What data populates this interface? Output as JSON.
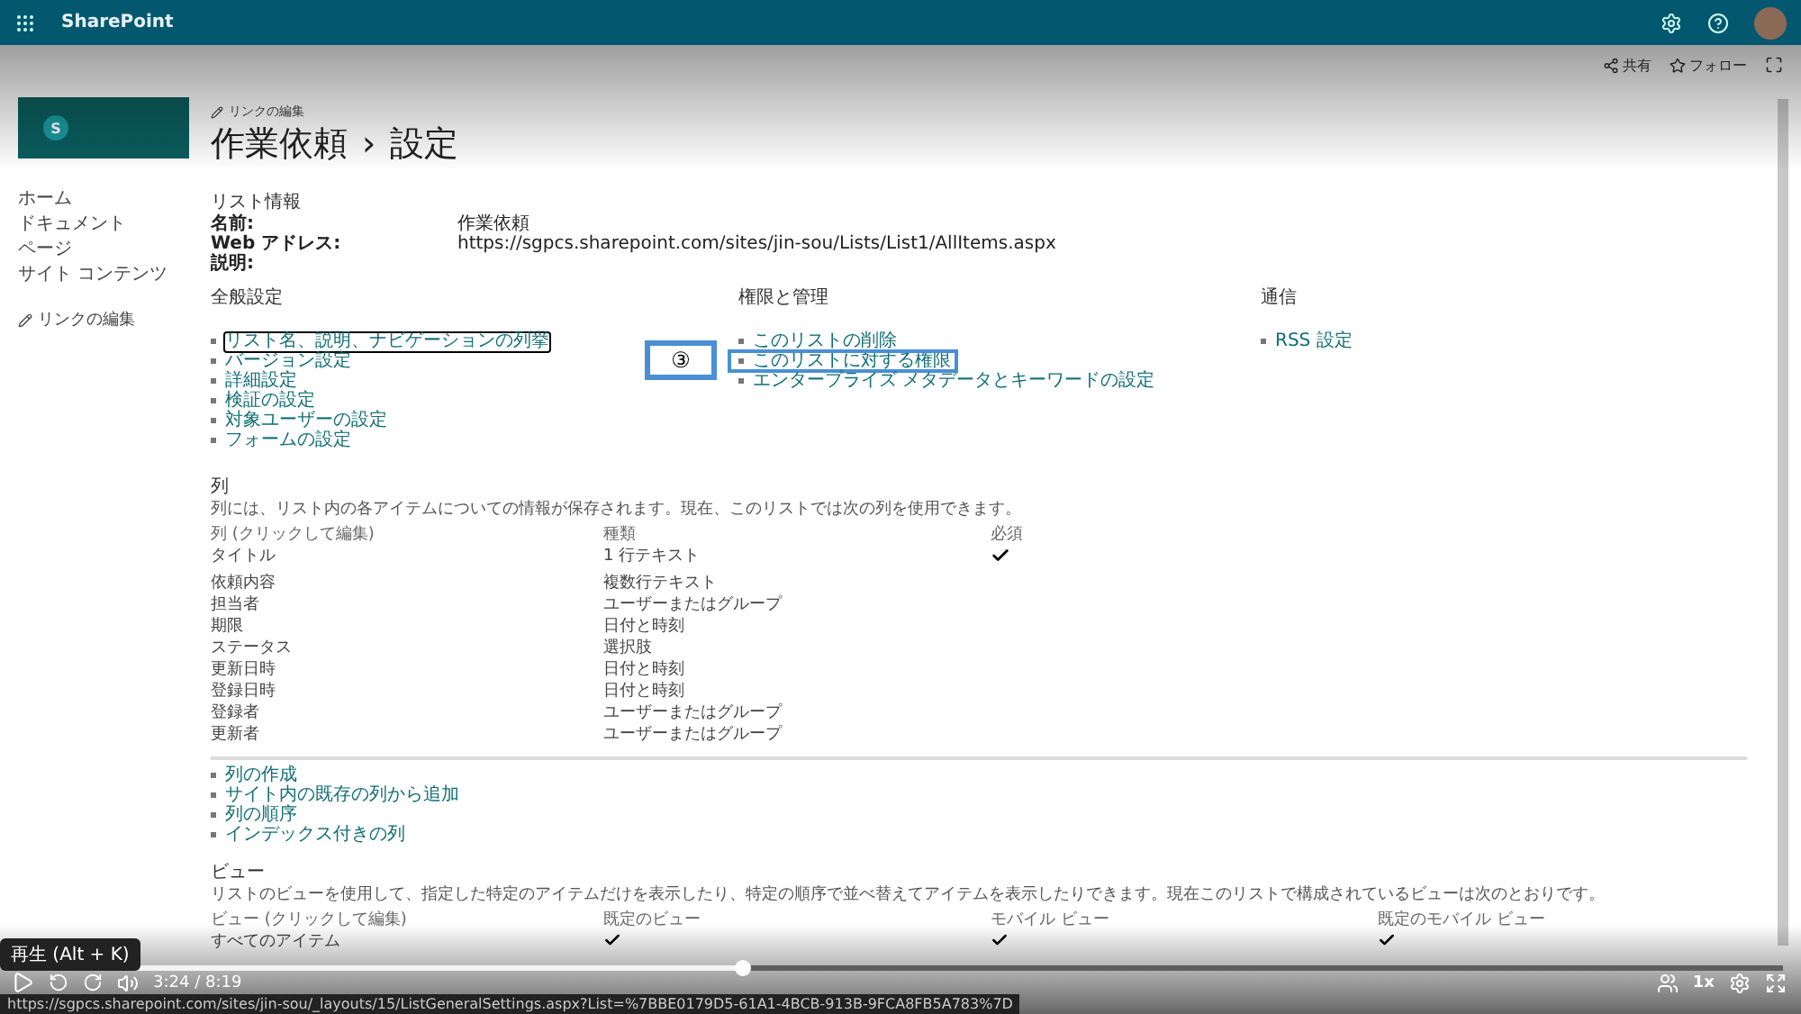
{
  "suite_bar": {
    "app_name": "SharePoint"
  },
  "command_bar": [
    {
      "label": "共有"
    },
    {
      "label": "フォロー"
    }
  ],
  "header": {
    "logo_letter": "S",
    "edit_link": "リンクの編集",
    "title": "作業依頼",
    "separator": "›",
    "subtitle": "設定"
  },
  "left_nav": {
    "items": [
      {
        "label": "ホーム"
      },
      {
        "label": "ドキュメント"
      },
      {
        "label": "ページ"
      },
      {
        "label": "サイト コンテンツ"
      }
    ],
    "edit_link": "リンクの編集"
  },
  "list_info": {
    "heading": "リスト情報",
    "fields": [
      {
        "label": "名前:",
        "value": "作業依頼"
      },
      {
        "label": "Web アドレス:",
        "value": "https://sgpcs.sharepoint.com/sites/jin-sou/Lists/List1/AllItems.aspx"
      },
      {
        "label": "説明:"
      }
    ]
  },
  "settings_sections": [
    {
      "heading": "全般設定",
      "links": [
        {
          "label": "リスト名、説明、ナビゲーションの列挙",
          "focused": true
        },
        {
          "label": "バージョン設定",
          "focused": false
        },
        {
          "label": "詳細設定",
          "focused": false
        },
        {
          "label": "検証の設定",
          "focused": false
        },
        {
          "label": "対象ユーザーの設定",
          "focused": false
        },
        {
          "label": "フォームの設定",
          "focused": false
        }
      ]
    },
    {
      "heading": "権限と管理",
      "links": [
        {
          "label": "このリストの削除",
          "focused": false
        },
        {
          "label": "このリストに対する権限",
          "focused": false,
          "callout": "③"
        },
        {
          "label": "エンタープライズ メタデータとキーワードの設定",
          "focused": false
        }
      ]
    },
    {
      "heading": "通信",
      "links": [
        {
          "label": "RSS 設定",
          "focused": false
        }
      ]
    }
  ],
  "columns": {
    "heading": "列",
    "description": "列には、リスト内の各アイテムについての情報が保存されます。現在、このリストでは次の列を使用できます。",
    "headers": [
      "列 (クリックして編集)",
      "種類",
      "必須"
    ],
    "rows": [
      {
        "name": "タイトル",
        "type": "1 行テキスト",
        "required": true
      },
      {
        "name": "依頼内容",
        "type": "複数行テキスト",
        "required": false
      },
      {
        "name": "担当者",
        "type": "ユーザーまたはグループ",
        "required": false
      },
      {
        "name": "期限",
        "type": "日付と時刻",
        "required": false
      },
      {
        "name": "ステータス",
        "type": "選択肢",
        "required": false
      },
      {
        "name": "更新日時",
        "type": "日付と時刻",
        "required": false
      },
      {
        "name": "登録日時",
        "type": "日付と時刻",
        "required": false
      },
      {
        "name": "登録者",
        "type": "ユーザーまたはグループ",
        "required": false
      },
      {
        "name": "更新者",
        "type": "ユーザーまたはグループ",
        "required": false
      }
    ],
    "links": [
      "列の作成",
      "サイト内の既存の列から追加",
      "列の順序",
      "インデックス付きの列"
    ]
  },
  "views": {
    "heading": "ビュー",
    "description": "リストのビューを使用して、指定した特定のアイテムだけを表示したり、特定の順序で並べ替えてアイテムを表示したりできます。現在このリストで構成されているビューは次のとおりです。",
    "headers": [
      "ビュー (クリックして編集)",
      "既定のビュー",
      "モバイル ビュー",
      "既定のモバイル ビュー"
    ],
    "rows": [
      {
        "name": "すべてのアイテム",
        "default": true,
        "mobile": true,
        "default_mobile": true
      }
    ]
  },
  "video_player": {
    "tooltip": "再生 (Alt + K)",
    "level": 0.41,
    "time": "3:24 / 8:19",
    "speed": "1x",
    "status_url": "https://sgpcs.sharepoint.com/sites/jin-sou/_layouts/15/ListGeneralSettings.aspx?List=%7BBE0179D5-61A1-4BCB-913B-9FCA8FB5A783%7D"
  }
}
